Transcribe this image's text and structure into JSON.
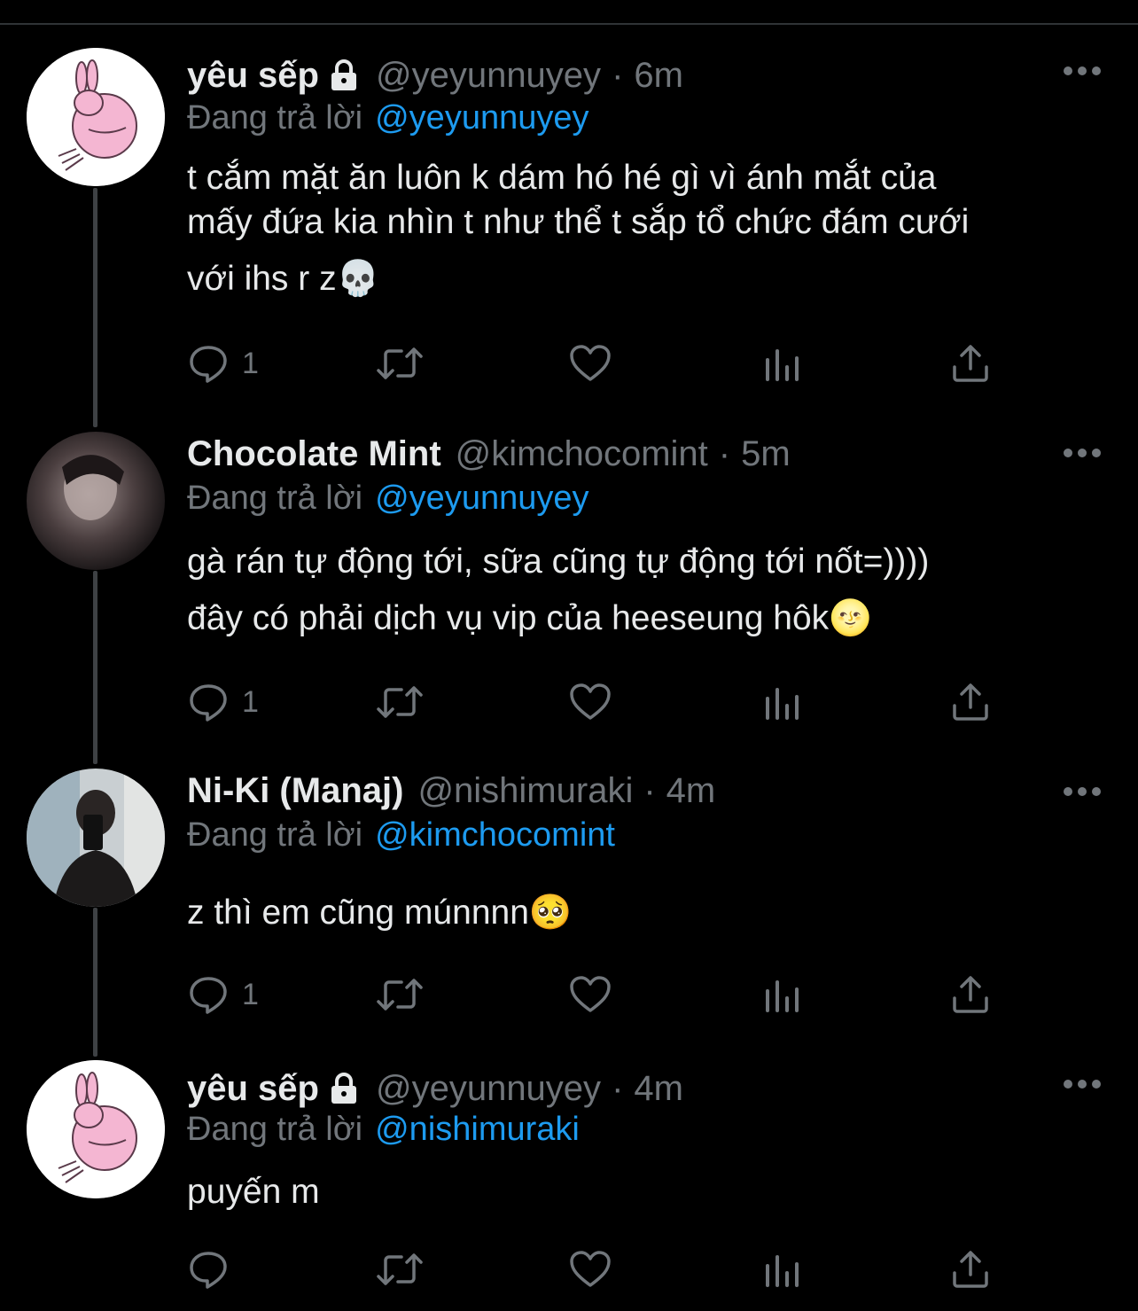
{
  "replying_prefix": "Đang trả lời",
  "tweets": [
    {
      "name": "yêu sếp",
      "locked": true,
      "handle": "@yeyunnuyey",
      "dot": "·",
      "time": "6m",
      "reply_to": "@yeyunnuyey",
      "lines": [
        "t cắm mặt ăn luôn k dám hó hé gì vì ánh mắt của",
        "mấy đứa kia nhìn t như thể t sắp tổ chức đám cưới",
        "với ihs r z💀"
      ],
      "reply_count": "1",
      "avatar_icon": "pink-bunny-avatar"
    },
    {
      "name": "Chocolate Mint",
      "locked": false,
      "handle": "@kimchocomint",
      "dot": "·",
      "time": "5m",
      "reply_to": "@yeyunnuyey",
      "lines": [
        "gà rán tự động tới, sữa cũng tự động tới nốt=))))",
        "đây có phải dịch vụ vip của heeseung hôk🌝"
      ],
      "reply_count": "1",
      "avatar_icon": "photo-avatar"
    },
    {
      "name": "Ni-Ki (Manaj)",
      "locked": false,
      "handle": "@nishimuraki",
      "dot": "·",
      "time": "4m",
      "reply_to": "@kimchocomint",
      "lines": [
        "z thì em cũng múnnnn🥺"
      ],
      "reply_count": "1",
      "avatar_icon": "mirror-selfie-avatar"
    },
    {
      "name": "yêu sếp",
      "locked": true,
      "handle": "@yeyunnuyey",
      "dot": "·",
      "time": "4m",
      "reply_to": "@nishimuraki",
      "lines": [
        "puyến m"
      ],
      "reply_count": "",
      "avatar_icon": "pink-bunny-avatar"
    }
  ],
  "colors": {
    "background": "#000000",
    "text": "#e7e9ea",
    "secondary": "#71767b",
    "mention": "#1d9bf0",
    "thread_line": "#3e4144"
  }
}
